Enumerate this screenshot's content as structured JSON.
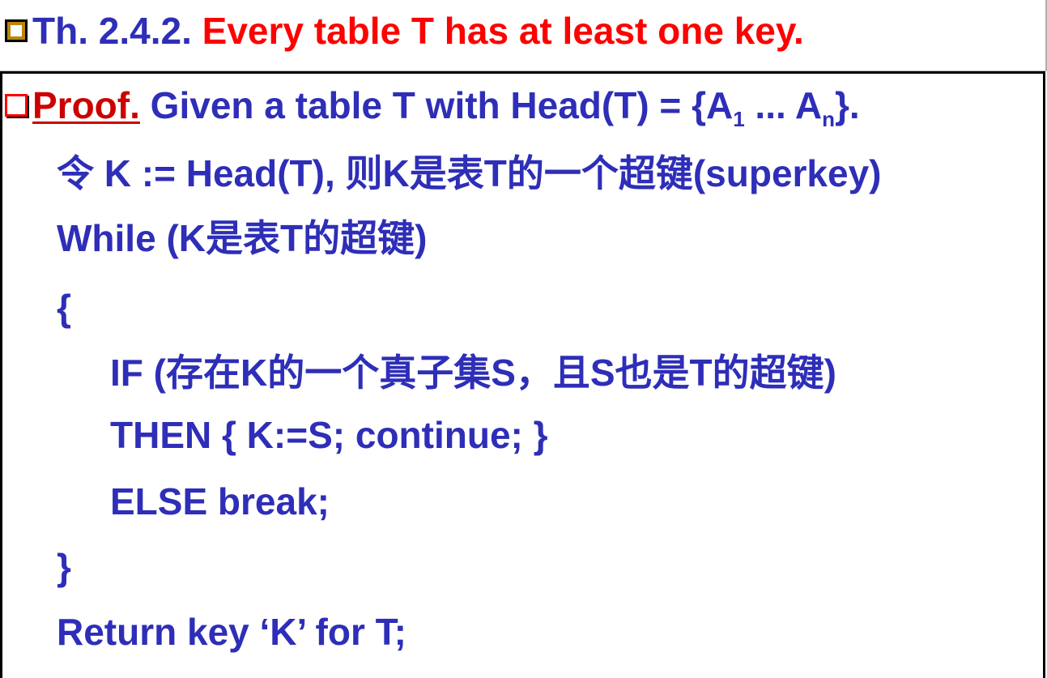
{
  "theorem": {
    "label": "Th. 2.4.2.",
    "statement": "Every table T has at least one key."
  },
  "proof": {
    "label": "Proof.",
    "intro_prefix": " Given a table T with Head(T) = {A",
    "sub1": "1",
    "intro_mid": " ... A",
    "subn": "n",
    "intro_suffix": "}.",
    "lines": [
      "令 K := Head(T), 则K是表T的一个超键(superkey)",
      "While (K是表T的超键)",
      "{",
      "IF (存在K的一个真子集S，且S也是T的超键)",
      "THEN  { K:=S;  continue; }",
      "ELSE  break;",
      "}",
      "Return key ‘K’ for T;"
    ]
  },
  "colors": {
    "blue_text": "#2e2eb8",
    "red_text": "#ff0000",
    "bullet_gold": "#b8860b"
  },
  "icons": {
    "theorem_bullet": "hollow-square-bullet-icon",
    "proof_bullet": "hollow-square-bullet-icon"
  }
}
